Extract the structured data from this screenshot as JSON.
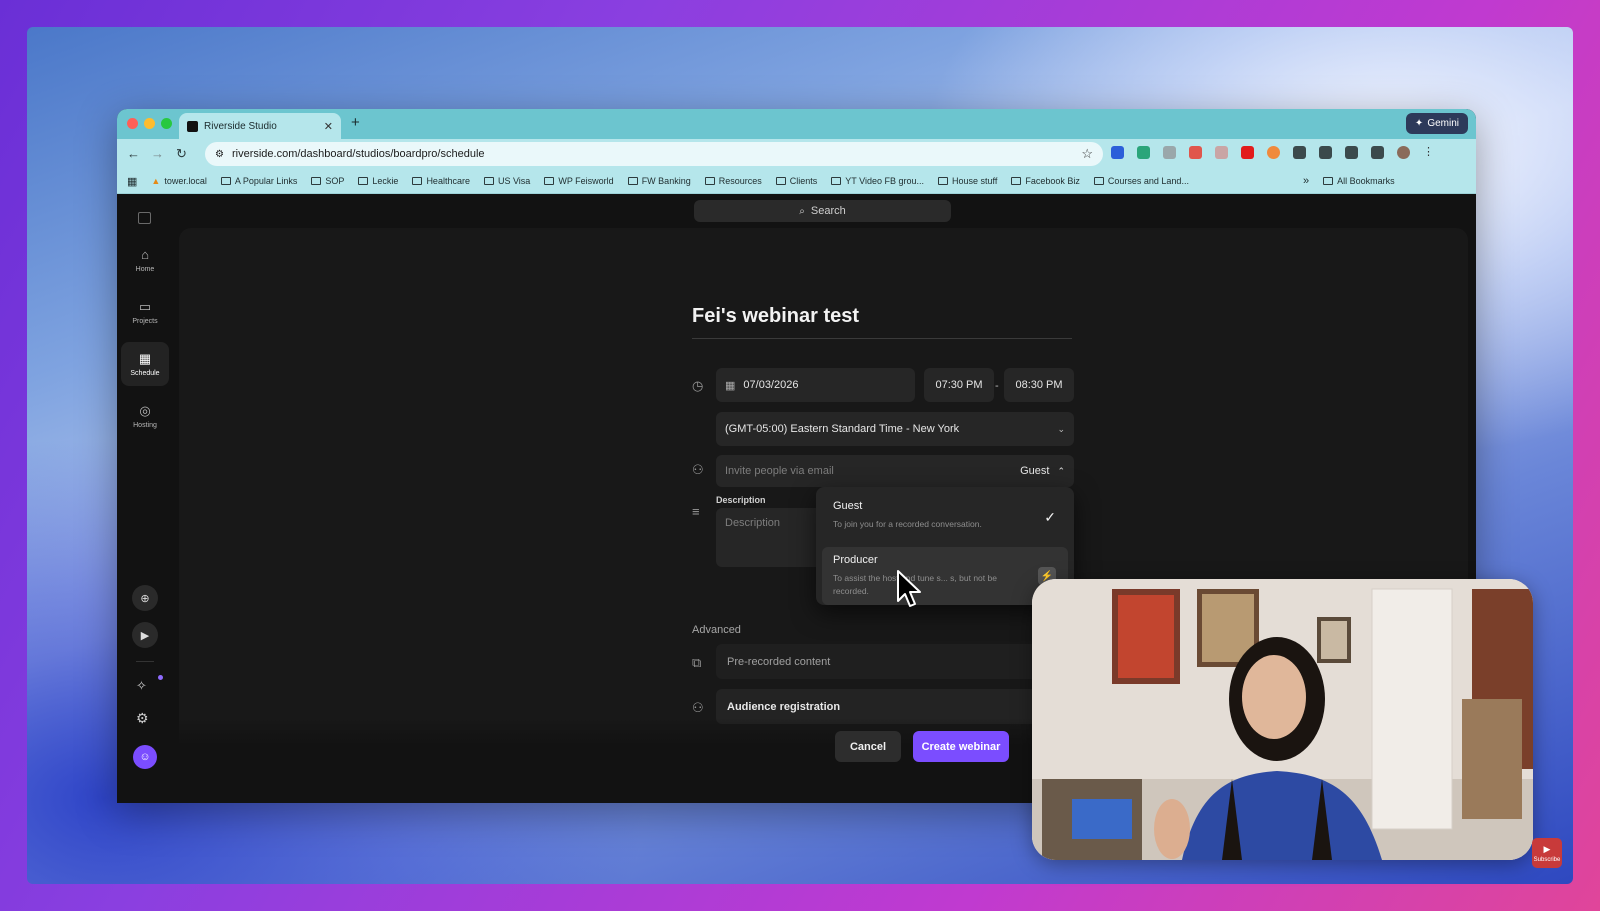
{
  "browser": {
    "tab_title": "Riverside Studio",
    "new_tab_label": "+",
    "gemini_label": "Gemini",
    "url": "riverside.com/dashboard/studios/boardpro/schedule",
    "bookmarks": [
      "tower.local",
      "A Popular Links",
      "SOP",
      "Leckie",
      "Healthcare",
      "US Visa",
      "WP Feisworld",
      "FW Banking",
      "Resources",
      "Clients",
      "YT Video FB grou...",
      "House stuff",
      "Facebook Biz",
      "Courses and Land..."
    ],
    "overflow_label": "»",
    "all_bookmarks_label": "All Bookmarks"
  },
  "sidebar": {
    "items": [
      {
        "label": "Home"
      },
      {
        "label": "Projects"
      },
      {
        "label": "Schedule"
      },
      {
        "label": "Hosting"
      }
    ]
  },
  "search": {
    "placeholder": "Search"
  },
  "form": {
    "title": "Fei's webinar test",
    "date": "07/03/2026",
    "start_time": "07:30 PM",
    "end_time": "08:30 PM",
    "dash": "-",
    "timezone": "(GMT-05:00) Eastern Standard Time - New York",
    "invite_placeholder": "Invite people via email",
    "role_selected": "Guest",
    "description_label": "Description",
    "description_placeholder": "Description",
    "advanced_label": "Advanced",
    "prerecorded_label": "Pre-recorded content",
    "prerecorded_on": false,
    "audience_label": "Audience registration",
    "audience_on": true,
    "cancel_label": "Cancel",
    "create_label": "Create webinar"
  },
  "role_dropdown": {
    "options": [
      {
        "title": "Guest",
        "desc": "To join you for a recorded conversation.",
        "selected": true
      },
      {
        "title": "Producer",
        "desc": "To assist the host and tune s... s, but not be recorded.",
        "selected": false
      }
    ]
  },
  "overlay": {
    "subscribe_label": "Subscribe"
  },
  "colors": {
    "accent": "#7b4dff",
    "tabbar": "#6cc5cf",
    "toolbar": "#b5e6eb",
    "app_bg": "#121212"
  }
}
